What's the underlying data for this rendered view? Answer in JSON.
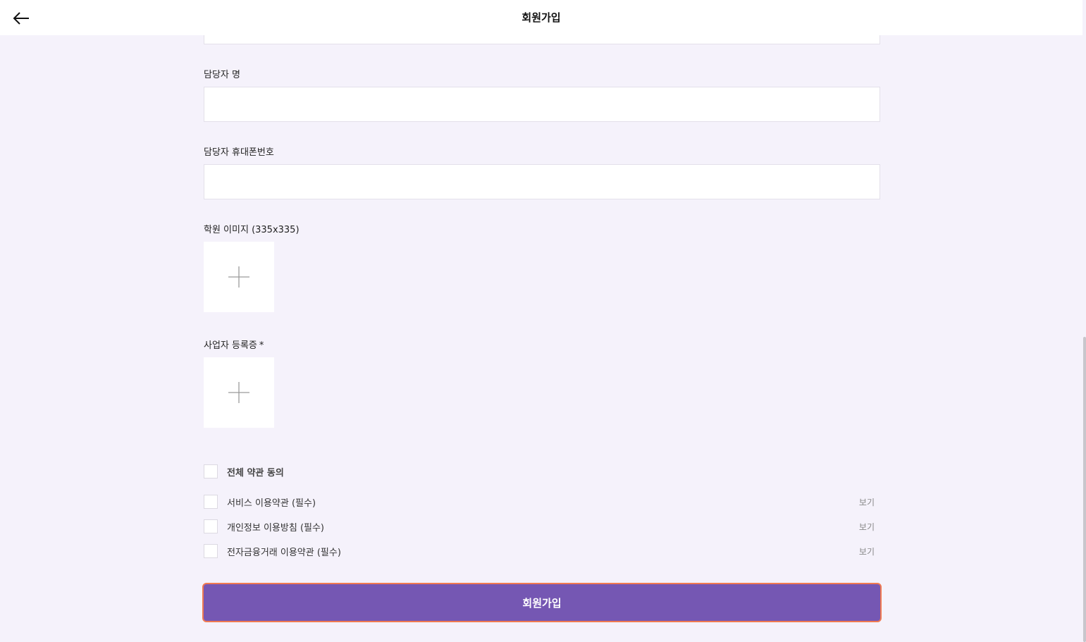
{
  "header": {
    "title": "회원가입",
    "back_icon": "arrow-left-icon"
  },
  "form": {
    "manager_name": {
      "label": "담당자 명",
      "value": "",
      "placeholder": ""
    },
    "manager_phone": {
      "label": "담당자 휴대폰번호",
      "value": "",
      "placeholder": ""
    },
    "academy_image": {
      "label": "학원 이미지 (335x335)",
      "icon": "plus-icon"
    },
    "business_registration": {
      "label": "사업자 등록증",
      "required_mark": "*",
      "icon": "plus-icon"
    }
  },
  "agreements": {
    "all": {
      "label": "전체 약관 동의",
      "checked": false
    },
    "items": [
      {
        "label": "서비스 이용약관 (필수)",
        "view_label": "보기",
        "checked": false
      },
      {
        "label": "개인정보 이용방침 (필수)",
        "view_label": "보기",
        "checked": false
      },
      {
        "label": "전자금융거래 이용약관 (필수)",
        "view_label": "보기",
        "checked": false
      }
    ]
  },
  "submit": {
    "label": "회원가입"
  },
  "colors": {
    "page_background": "#f5f2fb",
    "primary_button": "#7557b3",
    "button_focus_outline": "#f07a52"
  }
}
